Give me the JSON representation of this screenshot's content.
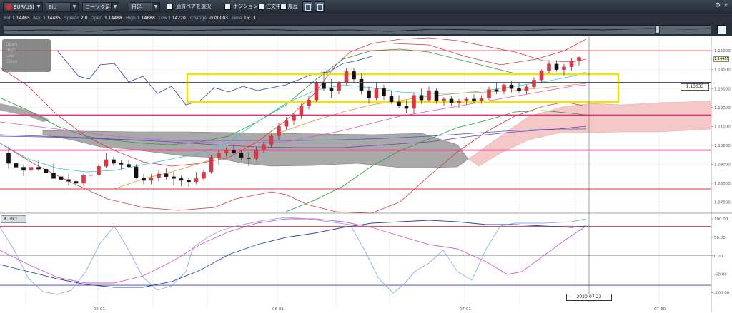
{
  "toolbar": {
    "symbol": "EUR/USD",
    "price_type": "Bid",
    "chart_type": "ローソク足",
    "period": "日足",
    "select_pair": "通貨ペアを選択",
    "position": "ポジション",
    "orders": "注文中",
    "history": "履歴"
  },
  "quote": {
    "bid_label": "Bid",
    "bid": "1.14465",
    "ask_label": "Ask",
    "ask": "1.14485",
    "spread_label": "Spread",
    "spread": "2.0",
    "open_label": "Open",
    "open": "1.14468",
    "high_label": "High",
    "high": "1.14688",
    "low_label": "Low",
    "low": "1.14220",
    "change_label": "Change",
    "change": "-0.00003",
    "time_label": "Time",
    "time": "15:11"
  },
  "ohlc_box": {
    "open": "Open",
    "high": "High",
    "low": "Low",
    "close": "Close"
  },
  "crosshair": {
    "price": "1.13033",
    "date": "2020-07-22"
  },
  "last_price": "1.14465",
  "rci_label": "RCI",
  "colors": {
    "up": "#d63a46",
    "down": "#111111",
    "highlight_box": "#f2e300",
    "cloud_bull": "#f4c2c2",
    "cloud_bear": "#9a9a9a"
  },
  "chart_data": {
    "type": "candlestick",
    "symbol": "EUR/USD",
    "timeframe": "日足",
    "x_ticks": [
      "05-01",
      "06-01",
      "07-01",
      "07-30"
    ],
    "price_axis": [
      "1.15000",
      "1.14000",
      "1.13000",
      "1.12000",
      "1.11000",
      "1.10000",
      "1.09000",
      "1.08000",
      "1.07000"
    ],
    "price_range": [
      1.0642,
      1.1576
    ],
    "rci_axis": [
      "100.00",
      "50.00",
      "0.00",
      "-50.00",
      "-100.00"
    ],
    "rci_range": [
      -105,
      106
    ],
    "horizontal_lines": [
      1.15,
      1.1333,
      1.116,
      1.0975,
      1.077
    ],
    "candles": [
      [
        1.096,
        1.0995,
        1.0878,
        1.0905
      ],
      [
        1.0905,
        1.0935,
        1.0868,
        1.0885
      ],
      [
        1.0885,
        1.09,
        1.0838,
        1.0868
      ],
      [
        1.0868,
        1.0905,
        1.0858,
        1.0885
      ],
      [
        1.0885,
        1.0925,
        1.0865,
        1.0875
      ],
      [
        1.0875,
        1.0895,
        1.0848,
        1.0855
      ],
      [
        1.0855,
        1.0905,
        1.0838,
        1.0825
      ],
      [
        1.0835,
        1.088,
        1.0765,
        1.082
      ],
      [
        1.082,
        1.085,
        1.079,
        1.081
      ],
      [
        1.081,
        1.0825,
        1.079,
        1.08
      ],
      [
        1.08,
        1.085,
        1.0785,
        1.0842
      ],
      [
        1.0842,
        1.088,
        1.083,
        1.0845
      ],
      [
        1.0845,
        1.09,
        1.084,
        1.089
      ],
      [
        1.089,
        1.096,
        1.088,
        1.0925
      ],
      [
        1.0925,
        1.094,
        1.089,
        1.0905
      ],
      [
        1.0905,
        1.0925,
        1.0875,
        1.09
      ],
      [
        1.09,
        1.092,
        1.088,
        1.0887
      ],
      [
        1.0887,
        1.09,
        1.0825,
        1.083
      ],
      [
        1.083,
        1.085,
        1.0795,
        1.0815
      ],
      [
        1.0815,
        1.085,
        1.0795,
        1.083
      ],
      [
        1.083,
        1.087,
        1.081,
        1.085
      ],
      [
        1.085,
        1.088,
        1.082,
        1.0835
      ],
      [
        1.0835,
        1.086,
        1.079,
        1.0825
      ],
      [
        1.0825,
        1.084,
        1.0785,
        1.0815
      ],
      [
        1.0815,
        1.083,
        1.078,
        1.0808
      ],
      [
        1.0808,
        1.086,
        1.0795,
        1.0825
      ],
      [
        1.0825,
        1.0875,
        1.0815,
        1.086
      ],
      [
        1.086,
        1.095,
        1.085,
        1.0935
      ],
      [
        1.0935,
        1.0975,
        1.09,
        1.096
      ],
      [
        1.096,
        1.099,
        1.094,
        1.0975
      ],
      [
        1.0975,
        1.1005,
        1.095,
        1.096
      ],
      [
        1.096,
        1.0975,
        1.092,
        1.0935
      ],
      [
        1.0935,
        1.0965,
        1.089,
        1.093
      ],
      [
        1.093,
        1.099,
        1.092,
        1.0975
      ],
      [
        1.0975,
        1.102,
        1.096,
        1.1005
      ],
      [
        1.1005,
        1.106,
        1.099,
        1.105
      ],
      [
        1.105,
        1.112,
        1.103,
        1.11
      ],
      [
        1.11,
        1.115,
        1.108,
        1.113
      ],
      [
        1.113,
        1.117,
        1.1105,
        1.116
      ],
      [
        1.116,
        1.122,
        1.114,
        1.121
      ],
      [
        1.121,
        1.126,
        1.119,
        1.124
      ],
      [
        1.124,
        1.134,
        1.123,
        1.133
      ],
      [
        1.133,
        1.139,
        1.129,
        1.13
      ],
      [
        1.13,
        1.135,
        1.125,
        1.129
      ],
      [
        1.129,
        1.134,
        1.127,
        1.133
      ],
      [
        1.133,
        1.141,
        1.132,
        1.139
      ],
      [
        1.139,
        1.141,
        1.133,
        1.135
      ],
      [
        1.135,
        1.138,
        1.127,
        1.129
      ],
      [
        1.129,
        1.131,
        1.122,
        1.125
      ],
      [
        1.125,
        1.133,
        1.124,
        1.13
      ],
      [
        1.13,
        1.132,
        1.124,
        1.126
      ],
      [
        1.126,
        1.129,
        1.122,
        1.123
      ],
      [
        1.123,
        1.1265,
        1.1195,
        1.121
      ],
      [
        1.121,
        1.124,
        1.117,
        1.1195
      ],
      [
        1.1195,
        1.128,
        1.117,
        1.1265
      ],
      [
        1.1265,
        1.13,
        1.122,
        1.124
      ],
      [
        1.124,
        1.131,
        1.123,
        1.129
      ],
      [
        1.129,
        1.13,
        1.122,
        1.1235
      ],
      [
        1.1235,
        1.1255,
        1.121,
        1.1245
      ],
      [
        1.1245,
        1.126,
        1.121,
        1.1225
      ],
      [
        1.1225,
        1.1245,
        1.12,
        1.1235
      ],
      [
        1.1235,
        1.1255,
        1.1215,
        1.1245
      ],
      [
        1.1245,
        1.127,
        1.1225,
        1.1235
      ],
      [
        1.1235,
        1.1265,
        1.122,
        1.125
      ],
      [
        1.125,
        1.131,
        1.124,
        1.1295
      ],
      [
        1.1295,
        1.133,
        1.127,
        1.1285
      ],
      [
        1.1285,
        1.1325,
        1.127,
        1.132
      ],
      [
        1.132,
        1.134,
        1.128,
        1.13
      ],
      [
        1.13,
        1.133,
        1.128,
        1.129
      ],
      [
        1.129,
        1.132,
        1.127,
        1.131
      ],
      [
        1.131,
        1.136,
        1.13,
        1.1345
      ],
      [
        1.1345,
        1.14,
        1.133,
        1.1395
      ],
      [
        1.1395,
        1.145,
        1.138,
        1.143
      ],
      [
        1.143,
        1.145,
        1.139,
        1.14
      ],
      [
        1.14,
        1.143,
        1.137,
        1.1415
      ],
      [
        1.1415,
        1.146,
        1.1395,
        1.1445
      ],
      [
        1.1445,
        1.147,
        1.142,
        1.1465
      ]
    ]
  }
}
